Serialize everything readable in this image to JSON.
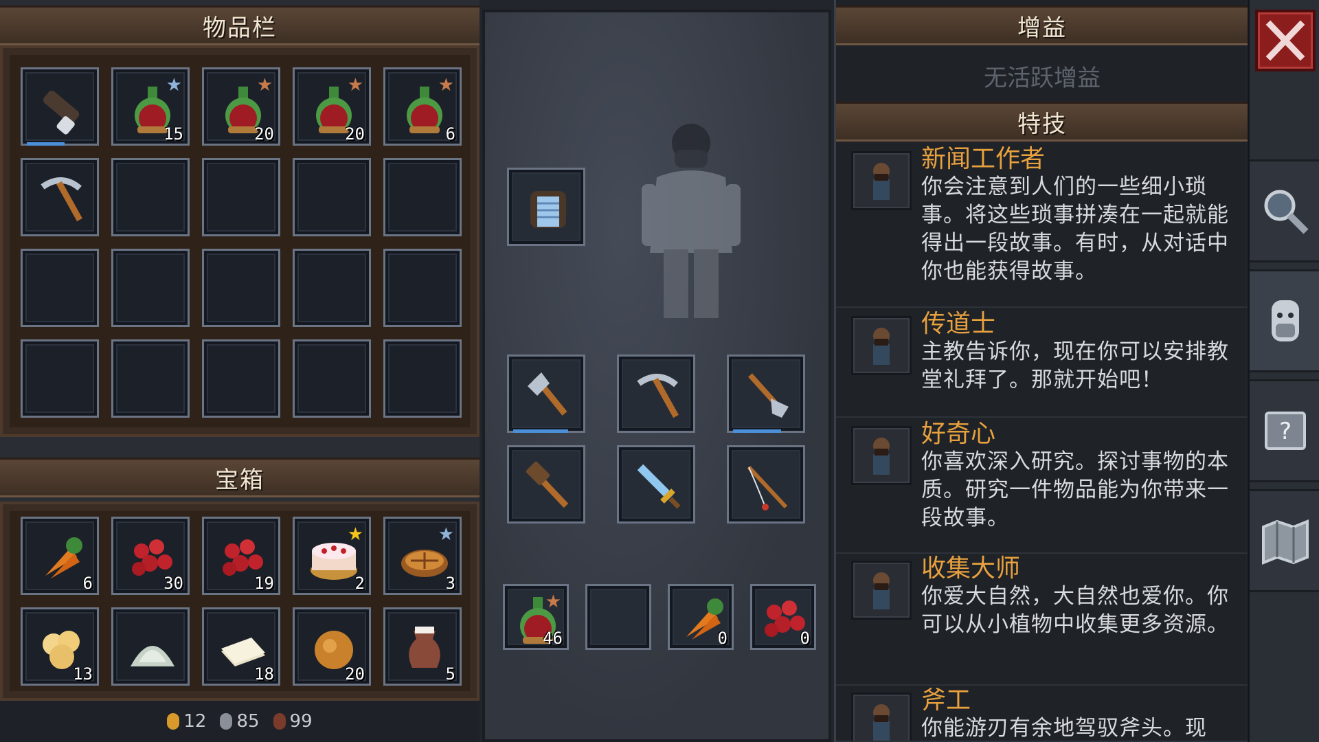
{
  "inventory": {
    "title": "物品栏",
    "slots": [
      {
        "icon": "flashlight-icon",
        "count": "",
        "star": "",
        "durability": 0.55
      },
      {
        "icon": "red-potion-icon",
        "count": "15",
        "star": "silver"
      },
      {
        "icon": "red-potion-icon",
        "count": "20",
        "star": "bronze"
      },
      {
        "icon": "red-potion-icon",
        "count": "20",
        "star": "bronze"
      },
      {
        "icon": "red-potion-icon",
        "count": "6",
        "star": "bronze"
      },
      {
        "icon": "pickaxe-icon",
        "count": ""
      }
    ]
  },
  "chest": {
    "title": "宝箱",
    "slots": [
      {
        "icon": "carrot-icon",
        "count": "6"
      },
      {
        "icon": "red-berries-icon",
        "count": "30"
      },
      {
        "icon": "red-berries-icon",
        "count": "19"
      },
      {
        "icon": "cake-icon",
        "count": "2",
        "star": "gold"
      },
      {
        "icon": "pie-icon",
        "count": "3",
        "star": "silver"
      },
      {
        "icon": "cauliflower-icon",
        "count": "13"
      },
      {
        "icon": "flour-pile-icon",
        "count": ""
      },
      {
        "icon": "paper-sheets-icon",
        "count": "18"
      },
      {
        "icon": "bread-bun-icon",
        "count": "20"
      },
      {
        "icon": "milk-jug-icon",
        "count": "5"
      }
    ]
  },
  "currency": {
    "gold": "12",
    "silver": "85",
    "copper": "99"
  },
  "equipment": {
    "armor": {
      "icon": "chest-armor-icon"
    },
    "tools": [
      {
        "icon": "axe-icon",
        "durability": 0.8
      },
      {
        "icon": "pickaxe-icon",
        "durability": 0
      },
      {
        "icon": "shovel-icon",
        "durability": 0.7
      },
      {
        "icon": "hammer-icon",
        "durability": 0
      },
      {
        "icon": "sword-icon",
        "durability": 0
      },
      {
        "icon": "fishing-rod-icon",
        "durability": 0
      }
    ],
    "quick": [
      {
        "icon": "red-potion-icon",
        "count": "46",
        "star": "bronze"
      },
      {
        "icon": "",
        "count": ""
      },
      {
        "icon": "carrot-icon",
        "count": "0"
      },
      {
        "icon": "red-berries-icon",
        "count": "0"
      }
    ]
  },
  "buffs": {
    "title": "增益",
    "empty_text": "无活跃增益"
  },
  "perks": {
    "title": "特技",
    "items": [
      {
        "name": "新闻工作者",
        "desc": "你会注意到人们的一些细小琐事。将这些琐事拼凑在一起就能得出一段故事。有时，从对话中你也能获得故事。"
      },
      {
        "name": "传道士",
        "desc": "主教告诉你，现在你可以安排教堂礼拜了。那就开始吧！"
      },
      {
        "name": "好奇心",
        "desc": "你喜欢深入研究。探讨事物的本质。研究一件物品能为你带来一段故事。"
      },
      {
        "name": "收集大师",
        "desc": "你爱大自然，大自然也爱你。你可以从小植物中收集更多资源。"
      },
      {
        "name": "斧工",
        "desc": "你能游刃有余地驾驭斧头。现"
      }
    ]
  },
  "colors": {
    "star_gold": "#f5c518",
    "star_silver": "#8fb3d9",
    "star_bronze": "#c77a4a"
  }
}
